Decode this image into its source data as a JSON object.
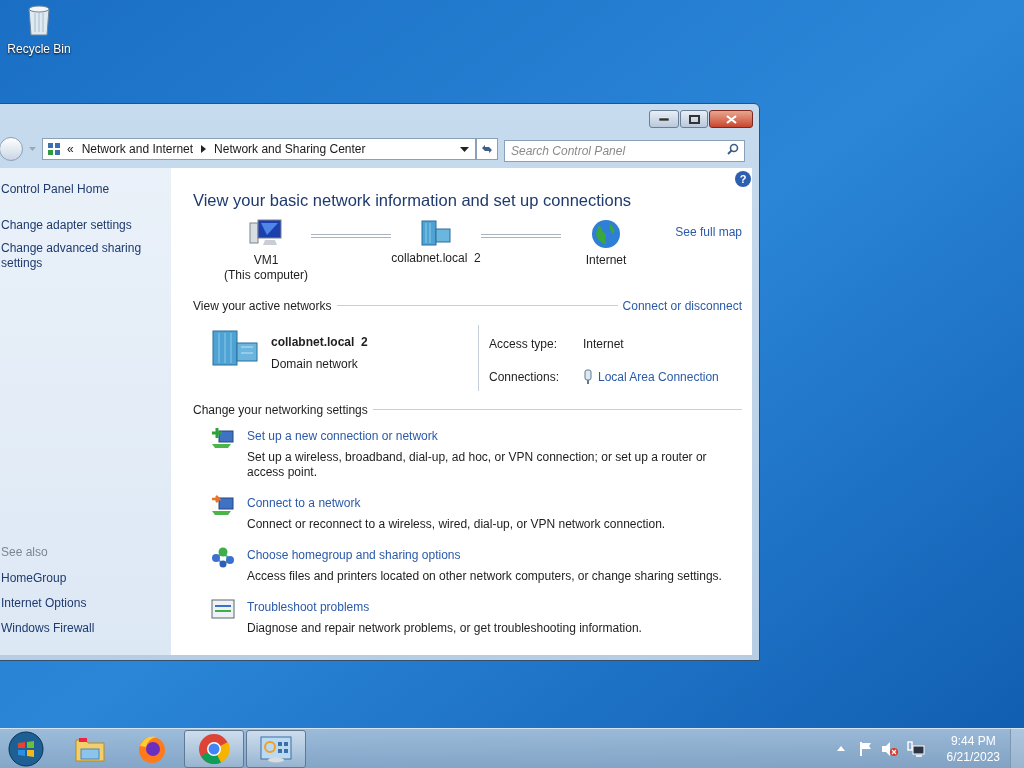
{
  "desktop_icons": [
    {
      "label": "Recycle Bin"
    }
  ],
  "window": {
    "breadcrumb_prefix": "«",
    "breadcrumb": [
      "Network and Internet",
      "Network and Sharing Center"
    ],
    "search": {
      "placeholder": "Search Control Panel"
    }
  },
  "sidebar": {
    "links": [
      "Control Panel Home",
      "Change adapter settings",
      "Change advanced sharing settings"
    ],
    "see_also_title": "See also",
    "see_also": [
      "HomeGroup",
      "Internet Options",
      "Windows Firewall"
    ]
  },
  "main": {
    "help_button": "?",
    "title": "View your basic network information and set up connections",
    "see_full_map": "See full map",
    "map_nodes": [
      {
        "kind": "computer",
        "label": "VM1",
        "sublabel": "(This computer)"
      },
      {
        "kind": "domain",
        "label": "collabnet.local  2"
      },
      {
        "kind": "globe",
        "label": "Internet"
      }
    ],
    "active_networks": {
      "heading": "View your active networks",
      "action": "Connect or disconnect",
      "name": "collabnet.local  2",
      "type": "Domain network",
      "access_label": "Access type:",
      "access_value": "Internet",
      "connections_label": "Connections:",
      "connections_value": "Local Area Connection"
    },
    "settings": {
      "heading": "Change your networking settings",
      "items": [
        {
          "kind": "new",
          "link": "Set up a new connection or network",
          "description": "Set up a wireless, broadband, dial-up, ad hoc, or VPN connection; or set up a router or access point."
        },
        {
          "kind": "connect",
          "link": "Connect to a network",
          "description": "Connect or reconnect to a wireless, wired, dial-up, or VPN network connection."
        },
        {
          "kind": "homegroup",
          "link": "Choose homegroup and sharing options",
          "description": "Access files and printers located on other network computers, or change sharing settings."
        },
        {
          "kind": "troubleshoot",
          "link": "Troubleshoot problems",
          "description": "Diagnose and repair network problems, or get troubleshooting information."
        }
      ]
    }
  },
  "taskbar": {
    "apps": [
      {
        "kind": "explorer",
        "running": false
      },
      {
        "kind": "firefox",
        "running": false
      },
      {
        "kind": "chrome",
        "running": true
      },
      {
        "kind": "controlpanel",
        "running": true
      }
    ],
    "clock": {
      "time": "9:44 PM",
      "date": "6/21/2023"
    }
  }
}
